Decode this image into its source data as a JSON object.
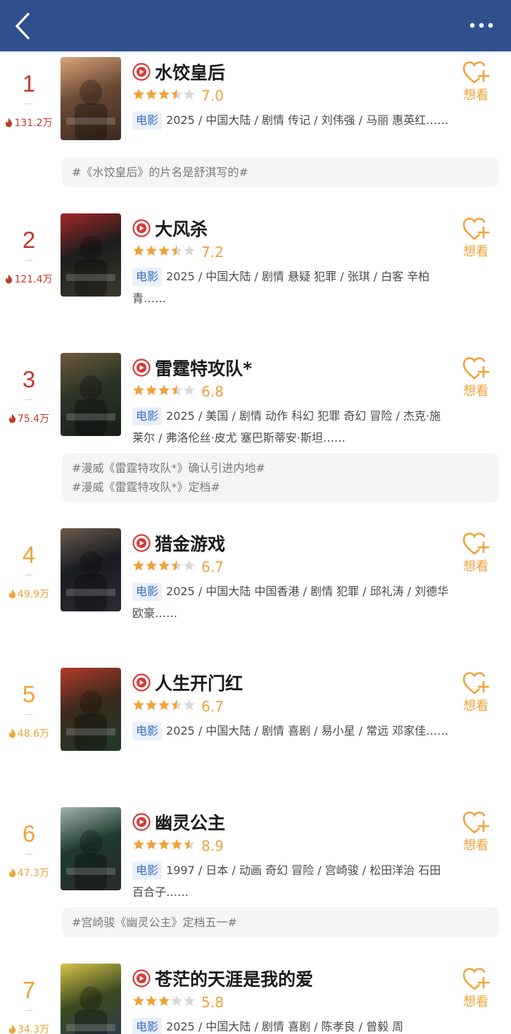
{
  "header": {
    "back_icon": "chevron-left-icon",
    "title": "",
    "more_icon": "more-icon",
    "bg_color": "#2f4f8d"
  },
  "colors": {
    "top_rank": "#c0392b",
    "mid_rank": "#f0a23a",
    "tag_bg": "#e8f0fb",
    "tag_text": "#3b6bc1",
    "star": "#f0a23a",
    "want": "#f0a23a"
  },
  "want_label": "想看",
  "items": [
    {
      "rank": "1",
      "heat": "131.2万",
      "title": "水饺皇后",
      "stars": 3.5,
      "score": "7.0",
      "tag": "电影",
      "info": "2025 / 中国大陆 / 剧情 传记 / 刘伟强 / 马丽 惠英红……",
      "hashtags": [
        "#《水饺皇后》的片名是舒淇写的#"
      ]
    },
    {
      "rank": "2",
      "heat": "121.4万",
      "title": "大风杀",
      "stars": 3.5,
      "score": "7.2",
      "tag": "电影",
      "info": "2025 / 中国大陆 / 剧情 悬疑 犯罪 / 张琪 / 白客 辛柏青……",
      "hashtags": []
    },
    {
      "rank": "3",
      "heat": "75.4万",
      "title": "雷霆特攻队*",
      "stars": 3.5,
      "score": "6.8",
      "tag": "电影",
      "info": "2025 / 美国 / 剧情 动作 科幻 犯罪 奇幻 冒险 / 杰克·施莱尔 / 弗洛伦丝·皮尤 塞巴斯蒂安·斯坦……",
      "hashtags": [
        "#漫威《雷霆特攻队*》确认引进内地#",
        "#漫威《雷霆特攻队*》定档#"
      ]
    },
    {
      "rank": "4",
      "heat": "49.9万",
      "title": "猎金游戏",
      "stars": 3.5,
      "score": "6.7",
      "tag": "电影",
      "info": "2025 / 中国大陆 中国香港 / 剧情 犯罪 / 邱礼涛 / 刘德华 欧豪……",
      "hashtags": []
    },
    {
      "rank": "5",
      "heat": "48.6万",
      "title": "人生开门红",
      "stars": 3.5,
      "score": "6.7",
      "tag": "电影",
      "info": "2025 / 中国大陆 / 剧情 喜剧 / 易小星 / 常远 邓家佳……",
      "hashtags": []
    },
    {
      "rank": "6",
      "heat": "47.3万",
      "title": "幽灵公主",
      "stars": 4.5,
      "score": "8.9",
      "tag": "电影",
      "info": "1997 / 日本 / 动画 奇幻 冒险 / 宫崎骏 / 松田洋治 石田百合子……",
      "hashtags": [
        "#宫崎骏《幽灵公主》定档五一#"
      ]
    },
    {
      "rank": "7",
      "heat": "34.3万",
      "title": "苍茫的天涯是我的爱",
      "stars": 3,
      "score": "5.8",
      "tag": "电影",
      "info": "2025 / 中国大陆 / 剧情 喜剧 / 陈孝良 / 曾毅 周",
      "hashtags": []
    }
  ]
}
